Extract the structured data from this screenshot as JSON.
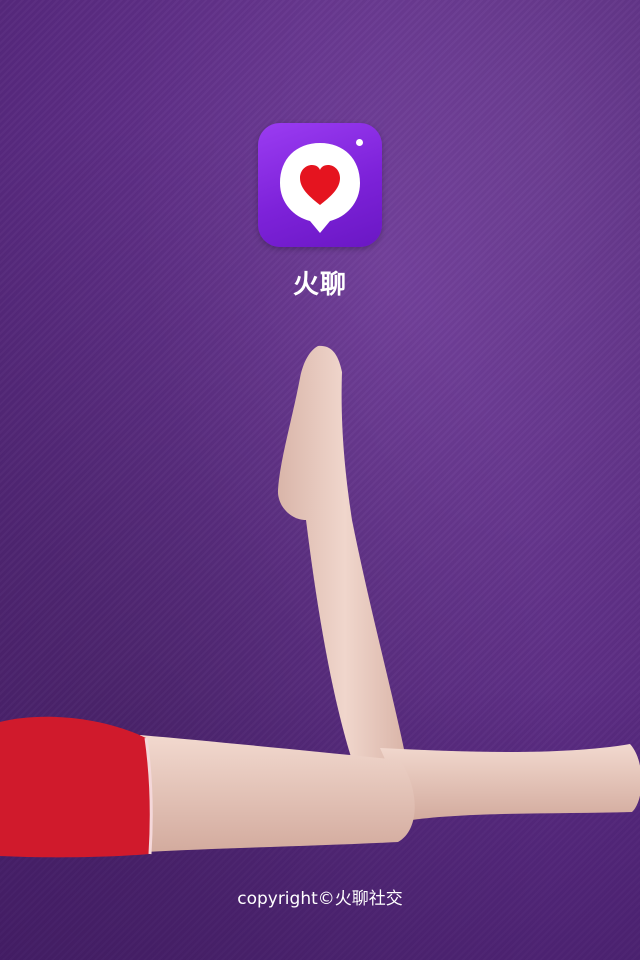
{
  "splash": {
    "app_name": "火聊",
    "copyright": "copyright©火聊社交",
    "icon": "heart-chat-bubble-icon",
    "colors": {
      "background": "#5f2f87",
      "icon_gradient_start": "#9b3cf2",
      "icon_gradient_end": "#6a17c4",
      "heart": "#e5141f",
      "shorts": "#d01a2c",
      "text": "#ffffff"
    }
  }
}
